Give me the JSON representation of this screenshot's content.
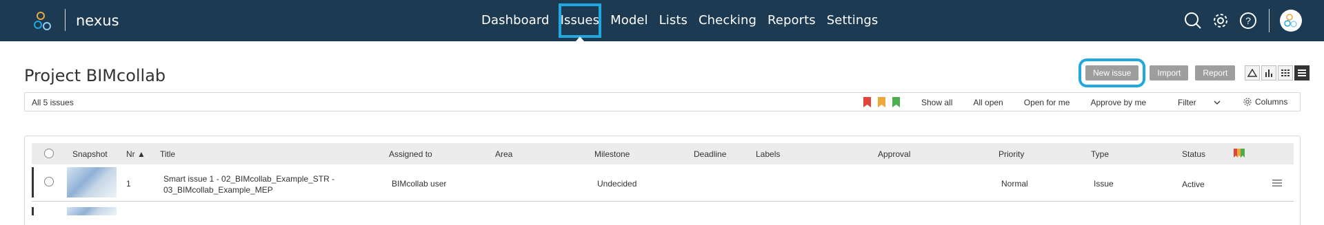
{
  "app": {
    "brand": "nexus"
  },
  "nav": {
    "items": [
      "Dashboard",
      "Issues",
      "Model",
      "Lists",
      "Checking",
      "Reports",
      "Settings"
    ],
    "active": "Issues"
  },
  "topbar_icons": [
    "search-icon",
    "gear-icon",
    "help-icon",
    "avatar"
  ],
  "page": {
    "title": "Project BIMcollab"
  },
  "actions": {
    "new_issue": "New issue",
    "import": "Import",
    "report": "Report"
  },
  "view_modes": [
    "warning-icon",
    "bar-chart-icon",
    "grid-icon",
    "list-icon"
  ],
  "filter": {
    "count_label": "All 5 issues",
    "flag_colors": [
      "#e0453c",
      "#f0a73a",
      "#4cae4c"
    ],
    "links": [
      "Show all",
      "All open",
      "Open for me",
      "Approve by me"
    ],
    "select_label": "Filter",
    "columns_label": "Columns"
  },
  "table": {
    "headers": [
      "Snapshot",
      "Nr ▲",
      "Title",
      "Assigned to",
      "Area",
      "Milestone",
      "Deadline",
      "Labels",
      "Approval",
      "Priority",
      "Type",
      "Status"
    ],
    "rows": [
      {
        "nr": "1",
        "title_line1": "Smart issue 1 - 02_BIMcollab_Example_STR -",
        "title_line2": "03_BIMcollab_Example_MEP",
        "assigned_to": "BIMcollab user",
        "area": "",
        "milestone": "Undecided",
        "deadline": "",
        "labels": "",
        "approval": "",
        "priority": "Normal",
        "type": "Issue",
        "status": "Active"
      }
    ]
  },
  "colors": {
    "topbar": "#1c3a52",
    "highlight": "#22a8e0",
    "button": "#9e9e9e"
  }
}
